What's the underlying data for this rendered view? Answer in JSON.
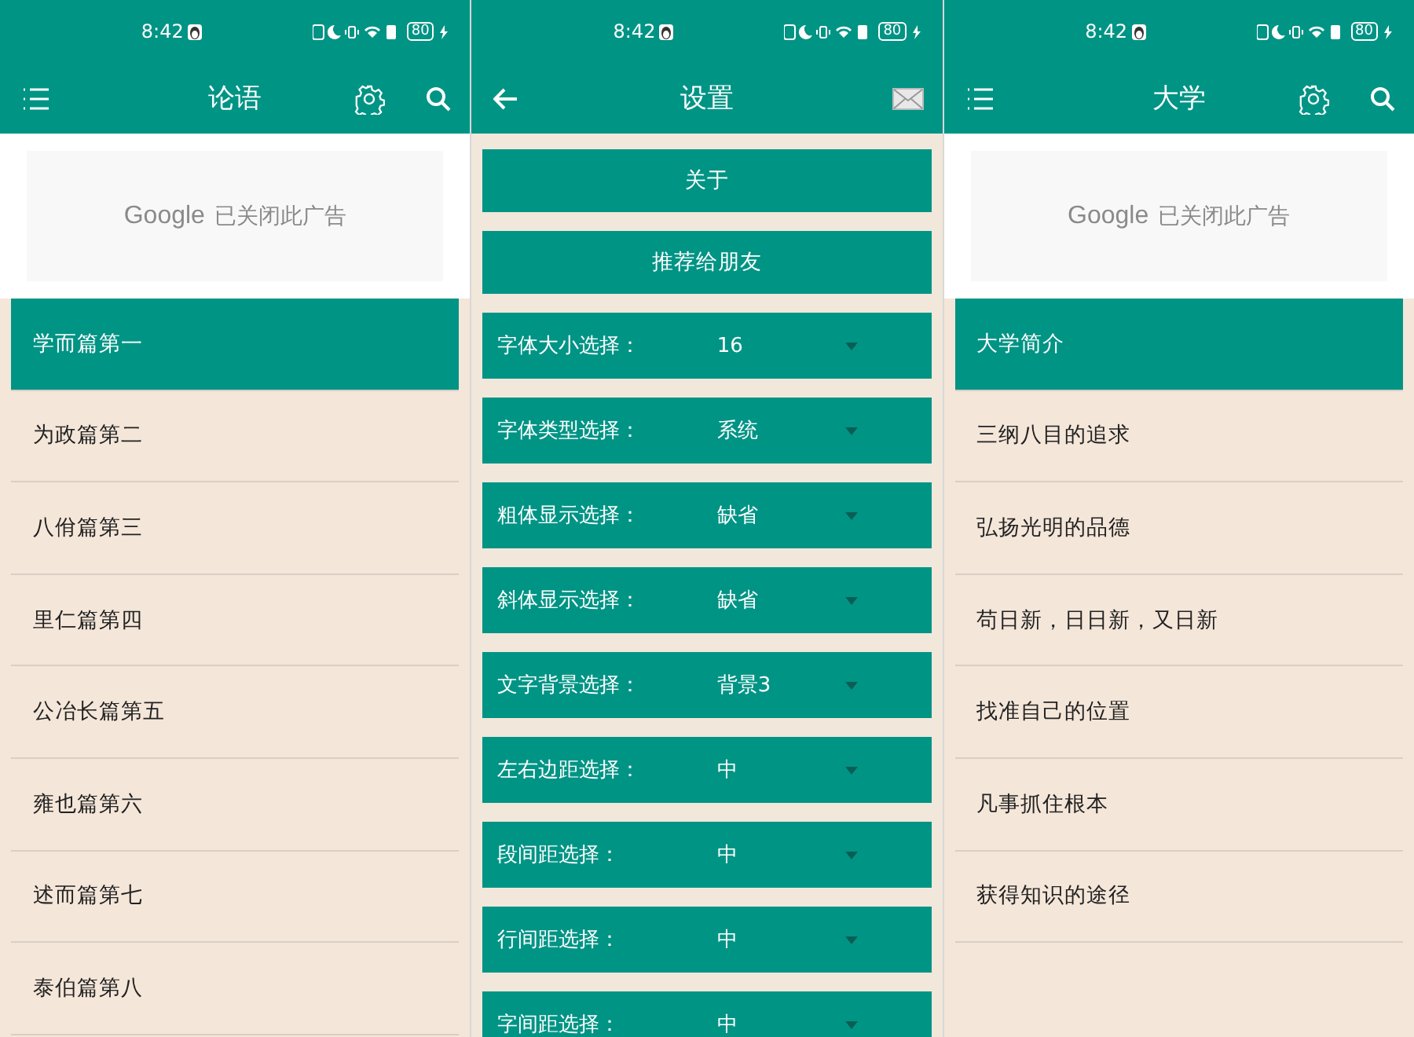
{
  "panels": [
    {
      "kind": "list",
      "status_bar": {
        "time": "8:42",
        "battery": "80"
      },
      "app_bar": {
        "title": "论语"
      },
      "ad": {
        "brand": "Google",
        "message": "已关闭此广告"
      },
      "items": [
        {
          "label": "学而篇第一",
          "selected": true
        },
        {
          "label": "为政篇第二",
          "selected": false
        },
        {
          "label": "八佾篇第三",
          "selected": false
        },
        {
          "label": "里仁篇第四",
          "selected": false
        },
        {
          "label": "公冶长篇第五",
          "selected": false
        },
        {
          "label": "雍也篇第六",
          "selected": false
        },
        {
          "label": "述而篇第七",
          "selected": false
        },
        {
          "label": "泰伯篇第八",
          "selected": false
        }
      ]
    },
    {
      "kind": "settings",
      "status_bar": {
        "time": "8:42",
        "battery": "80"
      },
      "app_bar": {
        "title": "设置"
      },
      "buttons": [
        "关于",
        "推荐给朋友"
      ],
      "options": [
        {
          "label": "字体大小选择：",
          "value": "16"
        },
        {
          "label": "字体类型选择：",
          "value": "系统"
        },
        {
          "label": "粗体显示选择：",
          "value": "缺省"
        },
        {
          "label": "斜体显示选择：",
          "value": "缺省"
        },
        {
          "label": "文字背景选择：",
          "value": "背景3"
        },
        {
          "label": "左右边距选择：",
          "value": "中"
        },
        {
          "label": "段间距选择：",
          "value": "中"
        },
        {
          "label": "行间距选择：",
          "value": "中"
        },
        {
          "label": "字间距选择：",
          "value": "中"
        }
      ]
    },
    {
      "kind": "list",
      "status_bar": {
        "time": "8:42",
        "battery": "80"
      },
      "app_bar": {
        "title": "大学"
      },
      "ad": {
        "brand": "Google",
        "message": "已关闭此广告"
      },
      "items": [
        {
          "label": "大学简介",
          "selected": true
        },
        {
          "label": "三纲八目的追求",
          "selected": false
        },
        {
          "label": "弘扬光明的品德",
          "selected": false
        },
        {
          "label": "苟日新，日日新，又日新",
          "selected": false
        },
        {
          "label": "找准自己的位置",
          "selected": false
        },
        {
          "label": "凡事抓住根本",
          "selected": false
        },
        {
          "label": "获得知识的途径",
          "selected": false
        }
      ]
    }
  ]
}
